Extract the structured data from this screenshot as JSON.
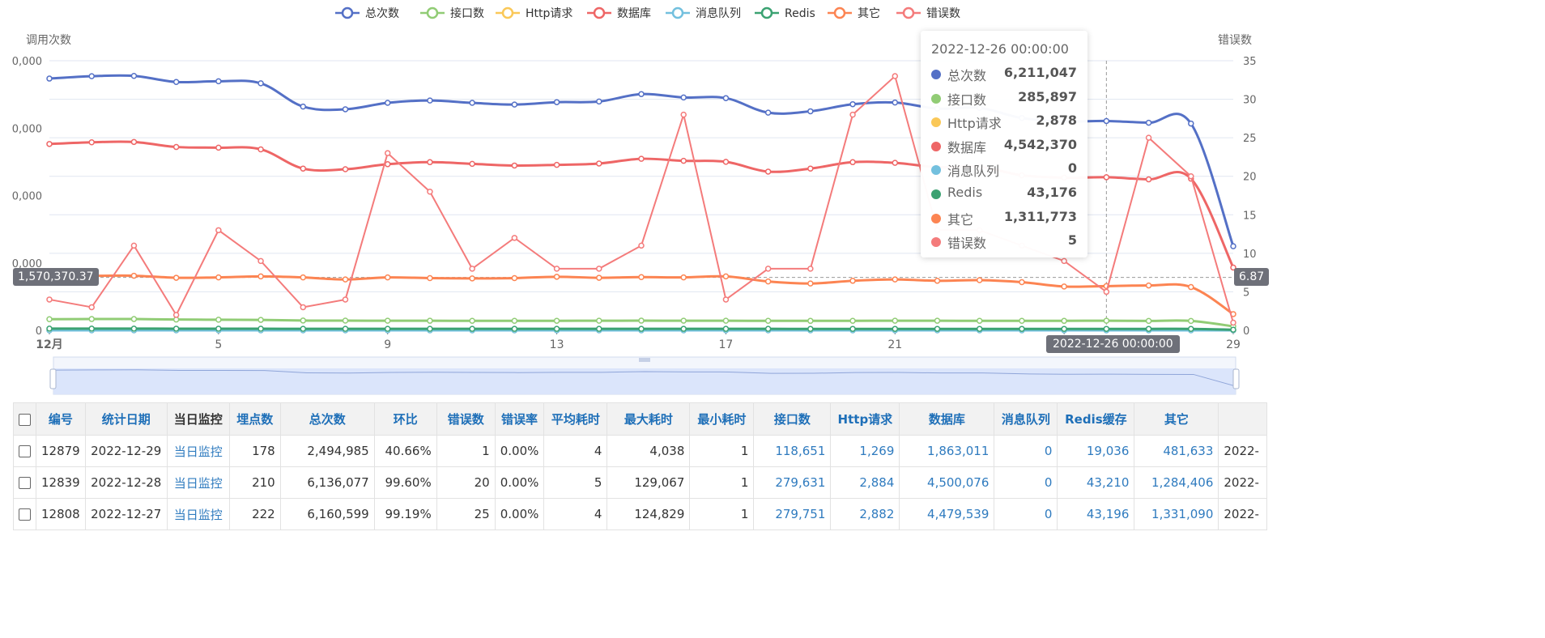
{
  "chart_data": {
    "type": "line",
    "x": [
      "2022-12-01",
      "2022-12-02",
      "2022-12-03",
      "2022-12-04",
      "2022-12-05",
      "2022-12-06",
      "2022-12-07",
      "2022-12-08",
      "2022-12-09",
      "2022-12-10",
      "2022-12-11",
      "2022-12-12",
      "2022-12-13",
      "2022-12-14",
      "2022-12-15",
      "2022-12-16",
      "2022-12-17",
      "2022-12-18",
      "2022-12-19",
      "2022-12-20",
      "2022-12-21",
      "2022-12-22",
      "2022-12-23",
      "2022-12-24",
      "2022-12-25",
      "2022-12-26",
      "2022-12-27",
      "2022-12-28",
      "2022-12-29"
    ],
    "x_tick_labels": [
      {
        "index": 0,
        "label": "12月"
      },
      {
        "index": 4,
        "label": "5"
      },
      {
        "index": 8,
        "label": "9"
      },
      {
        "index": 12,
        "label": "13"
      },
      {
        "index": 16,
        "label": "17"
      },
      {
        "index": 20,
        "label": "21"
      },
      {
        "index": 24,
        "label": "25"
      },
      {
        "index": 28,
        "label": "29"
      }
    ],
    "yleft_name": "调用次数",
    "yright_name": "错误数",
    "yleft_ticks": [
      "0",
      "0,000",
      "0,000",
      "0,000",
      "0,000"
    ],
    "yleft_max": 8000000,
    "yright_ticks": [
      "0",
      "5",
      "10",
      "15",
      "20",
      "25",
      "30",
      "35"
    ],
    "yright_max": 35,
    "series": [
      {
        "name": "总次数",
        "color": "#5470c6",
        "axis": "left",
        "values": [
          7470000,
          7540000,
          7550000,
          7370000,
          7390000,
          7330000,
          6640000,
          6560000,
          6750000,
          6820000,
          6750000,
          6700000,
          6770000,
          6790000,
          7010000,
          6910000,
          6890000,
          6460000,
          6500000,
          6710000,
          6760000,
          6580000,
          6600000,
          6300000,
          6200000,
          6211047,
          6160599,
          6136077,
          2494985
        ]
      },
      {
        "name": "接口数",
        "color": "#91cc75",
        "axis": "left",
        "values": [
          330000,
          335000,
          335000,
          320000,
          315000,
          310000,
          290000,
          288000,
          285000,
          284000,
          283000,
          282000,
          283000,
          285000,
          287000,
          286000,
          285000,
          282000,
          281000,
          283000,
          285000,
          284000,
          283000,
          282000,
          281000,
          285897,
          279751,
          279631,
          118651
        ]
      },
      {
        "name": "Http请求",
        "color": "#fac858",
        "axis": "left",
        "values": [
          3200,
          3200,
          3100,
          3100,
          3000,
          3000,
          2900,
          2900,
          2900,
          2900,
          2900,
          2900,
          2900,
          2900,
          2900,
          2900,
          2900,
          2900,
          2900,
          2900,
          2900,
          2900,
          2900,
          2900,
          2900,
          2878,
          2882,
          2884,
          1269
        ]
      },
      {
        "name": "数据库",
        "color": "#ee6666",
        "axis": "left",
        "values": [
          5530000,
          5580000,
          5590000,
          5440000,
          5420000,
          5370000,
          4800000,
          4780000,
          4930000,
          4990000,
          4940000,
          4890000,
          4910000,
          4950000,
          5090000,
          5030000,
          5000000,
          4710000,
          4800000,
          4990000,
          4970000,
          4840000,
          4850000,
          4600000,
          4530000,
          4542370,
          4479539,
          4500076,
          1863011
        ]
      },
      {
        "name": "消息队列",
        "color": "#73c0de",
        "axis": "left",
        "values": [
          0,
          0,
          0,
          0,
          0,
          0,
          0,
          0,
          0,
          0,
          0,
          0,
          0,
          0,
          0,
          0,
          0,
          0,
          0,
          0,
          0,
          0,
          0,
          0,
          0,
          0,
          0,
          0,
          0
        ]
      },
      {
        "name": "Redis",
        "color": "#3ba272",
        "axis": "left",
        "values": [
          50000,
          50000,
          50000,
          49000,
          48000,
          48000,
          45000,
          45000,
          45000,
          45000,
          44000,
          44000,
          44000,
          44000,
          44000,
          44000,
          44000,
          44000,
          43000,
          43000,
          43000,
          43000,
          43000,
          43000,
          43000,
          43176,
          43196,
          43210,
          19036
        ]
      },
      {
        "name": "其它",
        "color": "#fc8452",
        "axis": "left",
        "values": [
          1650000,
          1620000,
          1620000,
          1560000,
          1570000,
          1600000,
          1570000,
          1510000,
          1570000,
          1550000,
          1540000,
          1550000,
          1590000,
          1560000,
          1580000,
          1570000,
          1600000,
          1450000,
          1390000,
          1470000,
          1510000,
          1470000,
          1490000,
          1430000,
          1300000,
          1311773,
          1331090,
          1284406,
          481633
        ]
      },
      {
        "name": "错误数",
        "color": "#f47b7b",
        "axis": "right",
        "values": [
          4,
          3,
          11,
          2,
          13,
          9,
          3,
          4,
          23,
          18,
          8,
          12,
          8,
          8,
          11,
          28,
          4,
          8,
          8,
          28,
          33,
          13,
          13,
          11,
          9,
          5,
          25,
          20,
          1
        ]
      }
    ],
    "axis_pointer": {
      "left_label": "1,570,370.37",
      "right_label": "6.87",
      "x_label": "2022-12-26 00:00:00",
      "index": 25,
      "left_value": 1570370.37
    },
    "tooltip": {
      "title": "2022-12-26 00:00:00",
      "rows": [
        {
          "name": "总次数",
          "value": "6,211,047",
          "color": "#5470c6"
        },
        {
          "name": "接口数",
          "value": "285,897",
          "color": "#91cc75"
        },
        {
          "name": "Http请求",
          "value": "2,878",
          "color": "#fac858"
        },
        {
          "name": "数据库",
          "value": "4,542,370",
          "color": "#ee6666"
        },
        {
          "name": "消息队列",
          "value": "0",
          "color": "#73c0de"
        },
        {
          "name": "Redis",
          "value": "43,176",
          "color": "#3ba272"
        },
        {
          "name": "其它",
          "value": "1,311,773",
          "color": "#fc8452"
        },
        {
          "name": "错误数",
          "value": "5",
          "color": "#f47b7b"
        }
      ]
    }
  },
  "table": {
    "headers": [
      {
        "label": "编号",
        "style": "blue"
      },
      {
        "label": "统计日期",
        "style": "blue"
      },
      {
        "label": "当日监控",
        "style": "dark"
      },
      {
        "label": "埋点数",
        "style": "blue"
      },
      {
        "label": "总次数",
        "style": "blue"
      },
      {
        "label": "环比",
        "style": "blue"
      },
      {
        "label": "错误数",
        "style": "blue"
      },
      {
        "label": "错误率",
        "style": "blue"
      },
      {
        "label": "平均耗时",
        "style": "blue"
      },
      {
        "label": "最大耗时",
        "style": "blue"
      },
      {
        "label": "最小耗时",
        "style": "blue"
      },
      {
        "label": "接口数",
        "style": "blue"
      },
      {
        "label": "Http请求",
        "style": "blue"
      },
      {
        "label": "数据库",
        "style": "blue"
      },
      {
        "label": "消息队列",
        "style": "blue"
      },
      {
        "label": "Redis缓存",
        "style": "blue"
      },
      {
        "label": "其它",
        "style": "blue"
      },
      {
        "label": "",
        "style": "blue"
      }
    ],
    "rows": [
      [
        "12879",
        "2022-12-29",
        "当日监控",
        "178",
        "2,494,985",
        "40.66%",
        "1",
        "0.00%",
        "4",
        "4,038",
        "1",
        "118,651",
        "1,269",
        "1,863,011",
        "0",
        "19,036",
        "481,633",
        "2022-"
      ],
      [
        "12839",
        "2022-12-28",
        "当日监控",
        "210",
        "6,136,077",
        "99.60%",
        "20",
        "0.00%",
        "5",
        "129,067",
        "1",
        "279,631",
        "2,884",
        "4,500,076",
        "0",
        "43,210",
        "1,284,406",
        "2022-"
      ],
      [
        "12808",
        "2022-12-27",
        "当日监控",
        "222",
        "6,160,599",
        "99.19%",
        "25",
        "0.00%",
        "4",
        "124,829",
        "1",
        "279,751",
        "2,882",
        "4,479,539",
        "0",
        "43,196",
        "1,331,090",
        "2022-"
      ]
    ]
  }
}
